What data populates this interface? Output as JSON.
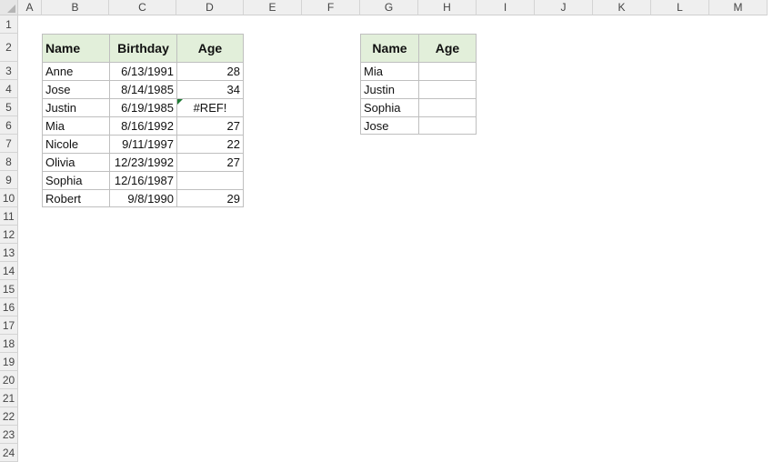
{
  "columns": [
    "A",
    "B",
    "C",
    "D",
    "E",
    "F",
    "G",
    "H",
    "I",
    "J",
    "K",
    "L",
    "M"
  ],
  "rows": [
    "1",
    "2",
    "3",
    "4",
    "5",
    "6",
    "7",
    "8",
    "9",
    "10",
    "11",
    "12",
    "13",
    "14",
    "15",
    "16",
    "17",
    "18",
    "19",
    "20",
    "21",
    "22",
    "23",
    "24"
  ],
  "table1": {
    "headers": [
      "Name",
      "Birthday",
      "Age"
    ],
    "rows": [
      {
        "name": "Anne",
        "birthday": "6/13/1991",
        "age": "28"
      },
      {
        "name": "Jose",
        "birthday": "8/14/1985",
        "age": "34"
      },
      {
        "name": "Justin",
        "birthday": "6/19/1985",
        "age": "#REF!"
      },
      {
        "name": "Mia",
        "birthday": "8/16/1992",
        "age": "27"
      },
      {
        "name": "Nicole",
        "birthday": "9/11/1997",
        "age": "22"
      },
      {
        "name": "Olivia",
        "birthday": "12/23/1992",
        "age": "27"
      },
      {
        "name": "Sophia",
        "birthday": "12/16/1987",
        "age": ""
      },
      {
        "name": "Robert",
        "birthday": "9/8/1990",
        "age": "29"
      }
    ]
  },
  "table2": {
    "headers": [
      "Name",
      "Age"
    ],
    "rows": [
      {
        "name": "Mia",
        "age": ""
      },
      {
        "name": "Justin",
        "age": ""
      },
      {
        "name": "Sophia",
        "age": ""
      },
      {
        "name": "Jose",
        "age": ""
      }
    ]
  },
  "colors": {
    "header_fill": "#e2efda",
    "error_indicator": "#1e7b34"
  }
}
